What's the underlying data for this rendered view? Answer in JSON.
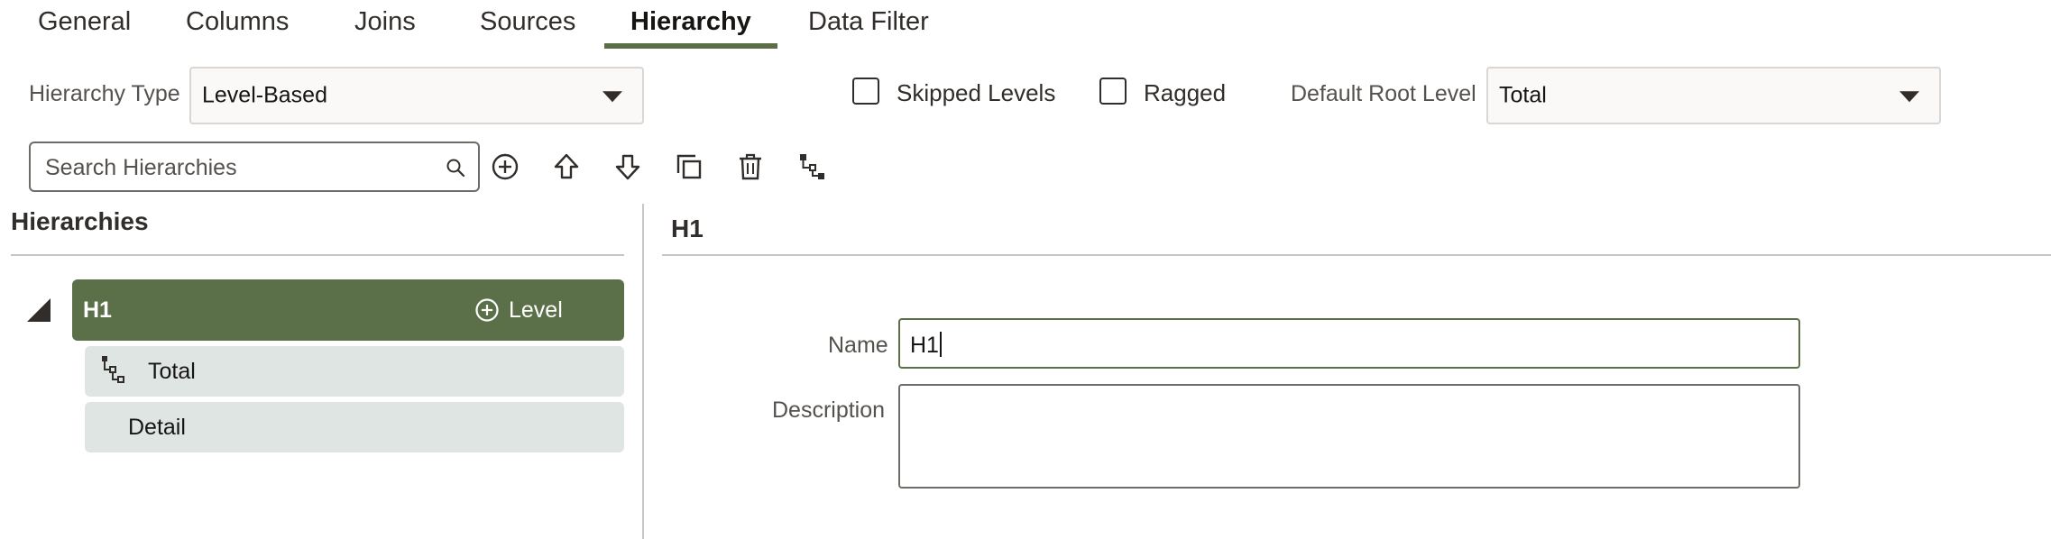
{
  "tabs": [
    {
      "label": "General",
      "active": false
    },
    {
      "label": "Columns",
      "active": false
    },
    {
      "label": "Joins",
      "active": false
    },
    {
      "label": "Sources",
      "active": false
    },
    {
      "label": "Hierarchy",
      "active": true
    },
    {
      "label": "Data Filter",
      "active": false
    }
  ],
  "options": {
    "hierarchy_type_label": "Hierarchy Type",
    "hierarchy_type_value": "Level-Based",
    "skipped_levels_label": "Skipped Levels",
    "skipped_levels_checked": false,
    "ragged_label": "Ragged",
    "ragged_checked": false,
    "default_root_level_label": "Default Root Level",
    "default_root_level_value": "Total"
  },
  "toolbar": {
    "search_placeholder": "Search Hierarchies",
    "icons": [
      "add-icon",
      "move-up-icon",
      "move-down-icon",
      "duplicate-icon",
      "delete-icon",
      "hierarchy-tree-icon"
    ]
  },
  "left_panel": {
    "title": "Hierarchies",
    "hierarchy": {
      "name": "H1",
      "add_level_label": "Level",
      "expanded": true,
      "levels": [
        {
          "name": "Total",
          "icon": "root-level-icon"
        },
        {
          "name": "Detail",
          "icon": ""
        }
      ]
    }
  },
  "detail": {
    "title": "H1",
    "name_label": "Name",
    "name_value": "H1",
    "description_label": "Description",
    "description_value": ""
  },
  "colors": {
    "accent": "#5b7049",
    "level_row_bg": "#dfe5e3",
    "tab_underline": "#5b6e45"
  }
}
